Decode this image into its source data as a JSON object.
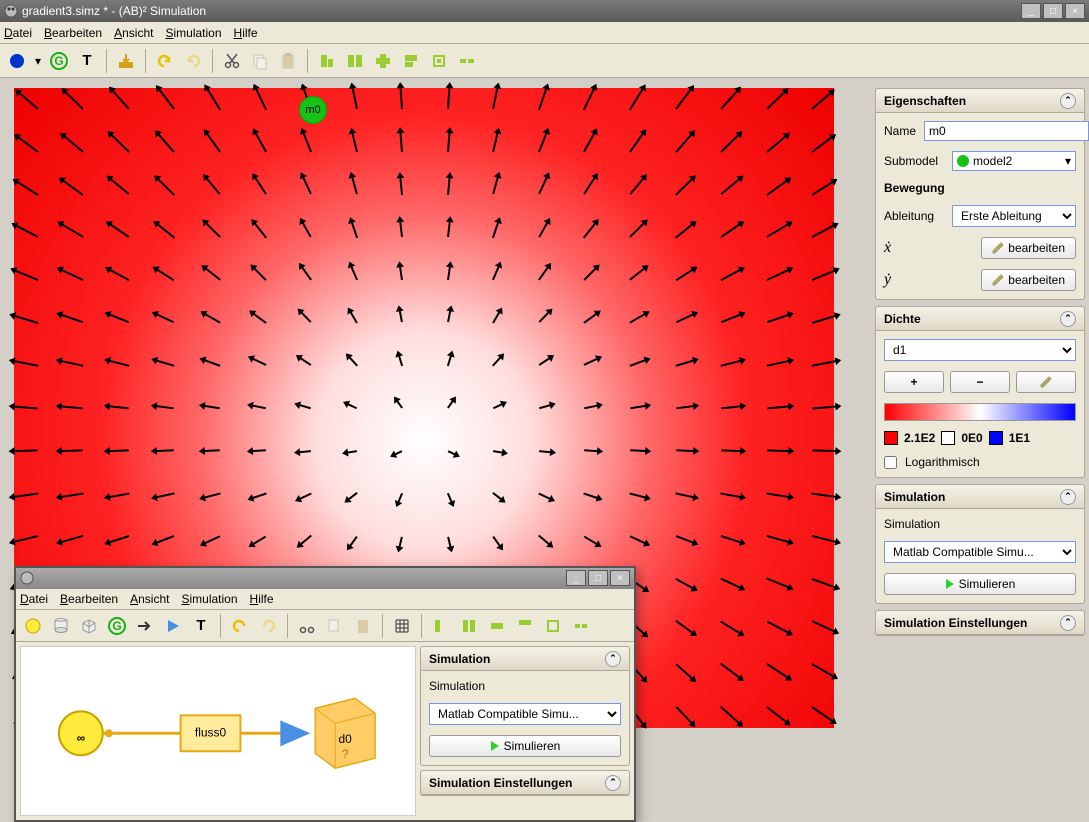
{
  "window": {
    "title": "gradient3.simz * - (AB)² Simulation"
  },
  "menu": {
    "file": "Datei",
    "edit": "Bearbeiten",
    "view": "Ansicht",
    "simulation": "Simulation",
    "help": "Hilfe"
  },
  "canvas": {
    "badge": "m0"
  },
  "props": {
    "header": "Eigenschaften",
    "name_label": "Name",
    "name_value": "m0",
    "submodel_label": "Submodel",
    "submodel_value": "model2",
    "movement_label": "Bewegung",
    "derivative_label": "Ableitung",
    "derivative_value": "Erste Ableitung",
    "xdot": "ẋ",
    "ydot": "ẏ",
    "edit_btn": "bearbeiten"
  },
  "density": {
    "header": "Dichte",
    "select": "d1",
    "legend_min": "2.1E2",
    "legend_mid": "0E0",
    "legend_max": "1E1",
    "log_label": "Logarithmisch",
    "colors": {
      "min": "#ff0000",
      "mid": "#ffffff",
      "max": "#0000ff"
    }
  },
  "simulation": {
    "header": "Simulation",
    "label": "Simulation",
    "engine": "Matlab Compatible Simu...",
    "run": "Simulieren",
    "settings_header": "Simulation Einstellungen"
  },
  "subwin": {
    "menu": {
      "file": "Datei",
      "edit": "Bearbeiten",
      "view": "Ansicht",
      "simulation": "Simulation",
      "help": "Hilfe"
    },
    "flow_label": "fluss0",
    "container_label": "d0",
    "container_sub": "?"
  }
}
